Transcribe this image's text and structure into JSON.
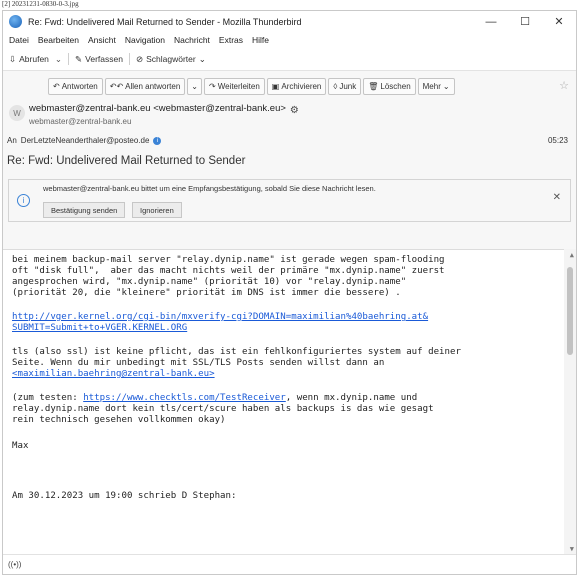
{
  "filename": "[2] 20231231-0830-0-3.jpg",
  "window": {
    "title": "Re: Fwd: Undelivered Mail Returned to Sender - Mozilla Thunderbird",
    "minimize": "—",
    "maximize": "☐",
    "close": "✕"
  },
  "menu": [
    "Datei",
    "Bearbeiten",
    "Ansicht",
    "Navigation",
    "Nachricht",
    "Extras",
    "Hilfe"
  ],
  "toolbar": {
    "get_mail": "Abrufen",
    "compose": "Verfassen",
    "tags": "Schlagwörter"
  },
  "message_actions": {
    "reply": "Antworten",
    "reply_all": "Allen antworten",
    "forward": "Weiterleiten",
    "archive": "Archivieren",
    "junk": "Junk",
    "delete": "Löschen",
    "more": "Mehr"
  },
  "header": {
    "avatar_letter": "W",
    "from_display": "webmaster@zentral-bank.eu <webmaster@zentral-bank.eu>",
    "from_email": "webmaster@zentral-bank.eu",
    "to_label": "An",
    "to_address": "DerLetzteNeanderthaler@posteo.de",
    "time": "05:23",
    "subject": "Re: Fwd: Undelivered Mail Returned to Sender"
  },
  "receipt": {
    "text": "webmaster@zentral-bank.eu bittet um eine Empfangsbestätigung, sobald Sie diese Nachricht lesen.",
    "send_button": "Bestätigung senden",
    "ignore_button": "Ignorieren"
  },
  "body": {
    "p1_l1": "bei meinem backup-mail server \"relay.dynip.name\" ist gerade wegen spam-flooding",
    "p1_l2": "oft \"disk full\",  aber das macht nichts weil der primäre \"mx.dynip.name\" zuerst",
    "p1_l3": "angesprochen wird, \"mx.dynip.name\" (priorität 10) vor \"relay.dynip.name\"",
    "p1_l4": "(priorität 20, die \"kleinere\" priorität im DNS ist immer die bessere) .",
    "link1_l1": "http://vger.kernel.org/cgi-bin/mxverify-cgi?DOMAIN=maximilian%40baehring.at&",
    "link1_l2": "SUBMIT=Submit+to+VGER.KERNEL.ORG",
    "p2_l1": "tls (also ssl) ist keine pflicht, das ist ein fehlkonfiguriertes system auf deiner",
    "p2_l2": "Seite. Wenn du mir unbedingt mit SSL/TLS Posts senden willst dann an",
    "p2_link": "<maximilian.baehring@zentral-bank.eu>",
    "p3_l1_a": "(zum testen: ",
    "p3_link": "https://www.checktls.com/TestReceiver",
    "p3_l1_b": ", wenn mx.dynip.name und",
    "p3_l2": "relay.dynip.name dort kein tls/cert/scure haben als backups is das wie gesagt",
    "p3_l3": "rein technisch gesehen vollkommen okay)",
    "sign": "Max",
    "quote": "Am 30.12.2023 um 19:00 schrieb D Stephan:"
  },
  "status": {
    "icon": "((•))"
  }
}
